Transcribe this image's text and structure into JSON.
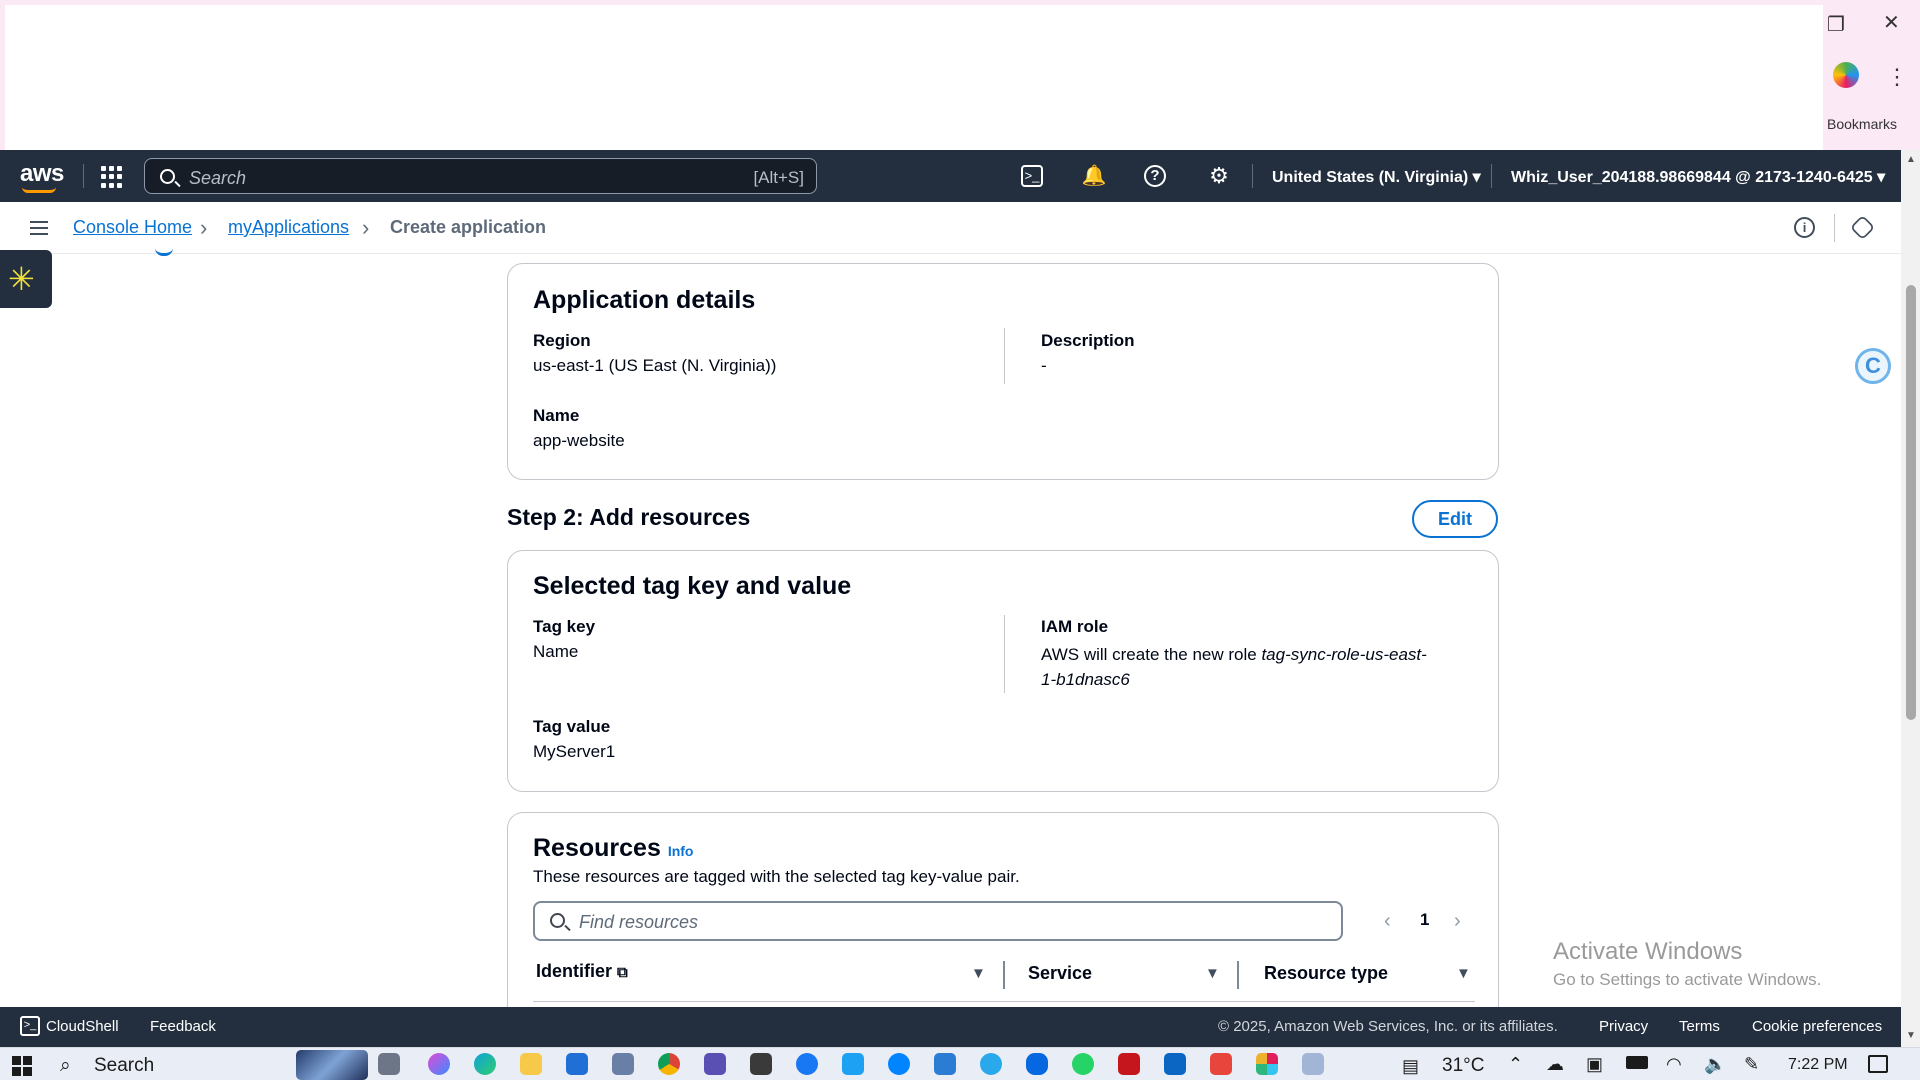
{
  "browser": {
    "bookmarks_label": "Bookmarks",
    "restore_icon": "restore-window-icon",
    "close_icon": "close-window-icon",
    "menu_icon": "more-vert-icon"
  },
  "nav": {
    "logo": "aws",
    "search_placeholder": "Search",
    "search_shortcut": "[Alt+S]",
    "region": "United States (N. Virginia)",
    "account": "Whiz_User_204188.98669844 @ 2173-1240-6425"
  },
  "breadcrumb": {
    "items": [
      "Console Home",
      "myApplications"
    ],
    "current": "Create application"
  },
  "app_details": {
    "title": "Application details",
    "region_label": "Region",
    "region_value": "us-east-1 (US East (N. Virginia))",
    "description_label": "Description",
    "description_value": "-",
    "name_label": "Name",
    "name_value": "app-website"
  },
  "step2": {
    "heading": "Step 2: Add resources",
    "edit_label": "Edit"
  },
  "tag_card": {
    "title": "Selected tag key and value",
    "tag_key_label": "Tag key",
    "tag_key_value": "Name",
    "iam_label": "IAM role",
    "iam_prefix": "AWS will create the new role ",
    "iam_role_line1": "tag-sync-role-us-east-",
    "iam_role_line2": "1-b1dnasc6",
    "tag_value_label": "Tag value",
    "tag_value_value": "MyServer1"
  },
  "resources": {
    "title": "Resources",
    "info": "Info",
    "description": "These resources are tagged with the selected tag key-value pair.",
    "find_placeholder": "Find resources",
    "page": "1",
    "columns": [
      "Identifier",
      "Service",
      "Resource type"
    ]
  },
  "footer": {
    "cloudshell": "CloudShell",
    "feedback": "Feedback",
    "copyright": "© 2025, Amazon Web Services, Inc. or its affiliates.",
    "privacy": "Privacy",
    "terms": "Terms",
    "cookie": "Cookie preferences"
  },
  "watermark": {
    "title": "Activate Windows",
    "subtitle": "Go to Settings to activate Windows."
  },
  "taskbar": {
    "search": "Search",
    "temperature": "31°C",
    "time": "7:22 PM"
  },
  "colors": {
    "aws_nav": "#232f3e",
    "link_blue": "#0972d3",
    "aws_orange": "#ff9900"
  }
}
